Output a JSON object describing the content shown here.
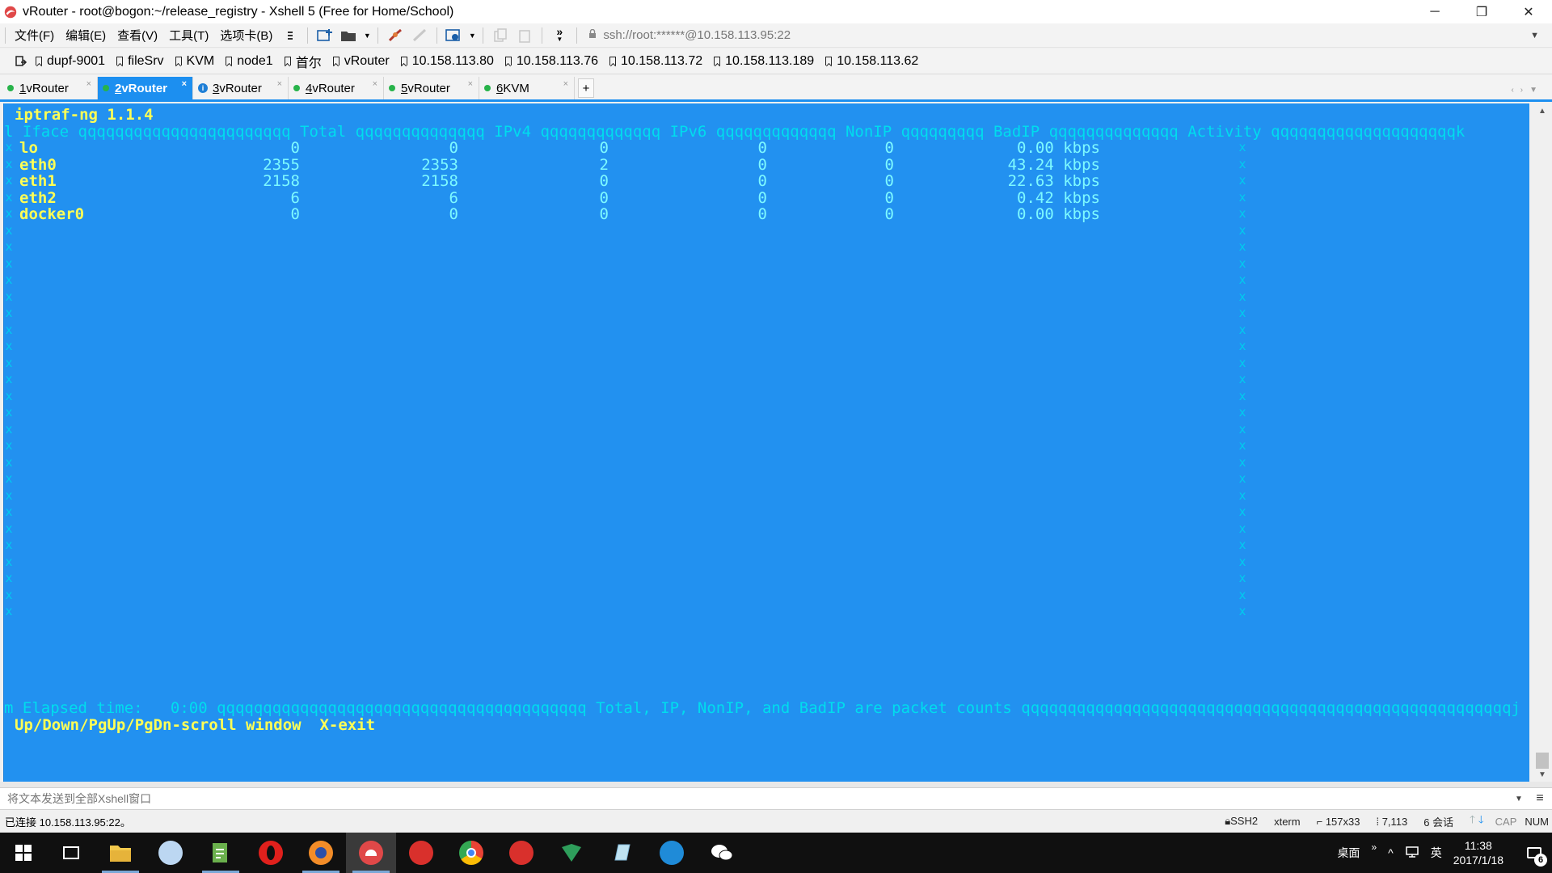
{
  "window": {
    "title": "vRouter - root@bogon:~/release_registry - Xshell 5 (Free for Home/School)",
    "minimize": "─",
    "restore": "❐",
    "close": "✕"
  },
  "menu": {
    "items": [
      "文件(F)",
      "编辑(E)",
      "查看(V)",
      "工具(T)",
      "选项卡(B)"
    ],
    "address": "ssh://root:******@10.158.113.95:22"
  },
  "links": [
    "dupf-9001",
    "fileSrv",
    "KVM",
    "node1",
    "首尔",
    "vRouter",
    "10.158.113.80",
    "10.158.113.76",
    "10.158.113.72",
    "10.158.113.189",
    "10.158.113.62"
  ],
  "tabs": [
    {
      "num": "1",
      "label": "vRouter",
      "status": "dot"
    },
    {
      "num": "2",
      "label": "vRouter",
      "status": "dot",
      "active": true
    },
    {
      "num": "3",
      "label": "vRouter",
      "status": "info"
    },
    {
      "num": "4",
      "label": "vRouter",
      "status": "dot"
    },
    {
      "num": "5",
      "label": "vRouter",
      "status": "dot"
    },
    {
      "num": "6",
      "label": "KVM",
      "status": "dot"
    }
  ],
  "terminal": {
    "title": "iptraf-ng 1.1.4",
    "header": "l Iface qqqqqqqqqqqqqqqqqqqqqqq Total qqqqqqqqqqqqqq IPv4 qqqqqqqqqqqqq IPv6 qqqqqqqqqqqqq NonIP qqqqqqqqq BadIP qqqqqqqqqqqqqq Activity qqqqqqqqqqqqqqqqqqqqk",
    "rows": [
      {
        "iface": "lo",
        "total": "0",
        "ipv4": "0",
        "ipv6": "0",
        "nonip": "0",
        "badip": "0",
        "activity": "0.00 kbps"
      },
      {
        "iface": "eth0",
        "total": "2355",
        "ipv4": "2353",
        "ipv6": "2",
        "nonip": "0",
        "badip": "0",
        "activity": "43.24 kbps"
      },
      {
        "iface": "eth1",
        "total": "2158",
        "ipv4": "2158",
        "ipv6": "0",
        "nonip": "0",
        "badip": "0",
        "activity": "22.63 kbps"
      },
      {
        "iface": "eth2",
        "total": "6",
        "ipv4": "6",
        "ipv6": "0",
        "nonip": "0",
        "badip": "0",
        "activity": "0.42 kbps"
      },
      {
        "iface": "docker0",
        "total": "0",
        "ipv4": "0",
        "ipv6": "0",
        "nonip": "0",
        "badip": "0",
        "activity": "0.00 kbps"
      }
    ],
    "footer": "m Elapsed time:   0:00 qqqqqqqqqqqqqqqqqqqqqqqqqqqqqqqqqqqqqqqq Total, IP, NonIP, and BadIP are packet counts qqqqqqqqqqqqqqqqqqqqqqqqqqqqqqqqqqqqqqqqqqqqqqqqqqqqqj",
    "help": "Up/Down/PgUp/PgDn-scroll window  X-exit",
    "side_char": "x"
  },
  "compose": {
    "placeholder": "将文本发送到全部Xshell窗口"
  },
  "status": {
    "connection": "已连接 10.158.113.95:22。",
    "protocol": "SSH2",
    "term": "xterm",
    "size": "157x33",
    "cursor": "7,113",
    "sessions": "6 会话",
    "cap": "CAP",
    "num": "NUM"
  },
  "taskbar": {
    "desktop_label": "桌面",
    "ime": "英",
    "time": "11:38",
    "date": "2017/1/18",
    "notifications": "6"
  },
  "colors": {
    "terminal_bg": "#2291f0",
    "tab_active": "#1c8ff0",
    "terminal_yellow": "#ffff55",
    "terminal_cyan": "#7df9ff"
  }
}
